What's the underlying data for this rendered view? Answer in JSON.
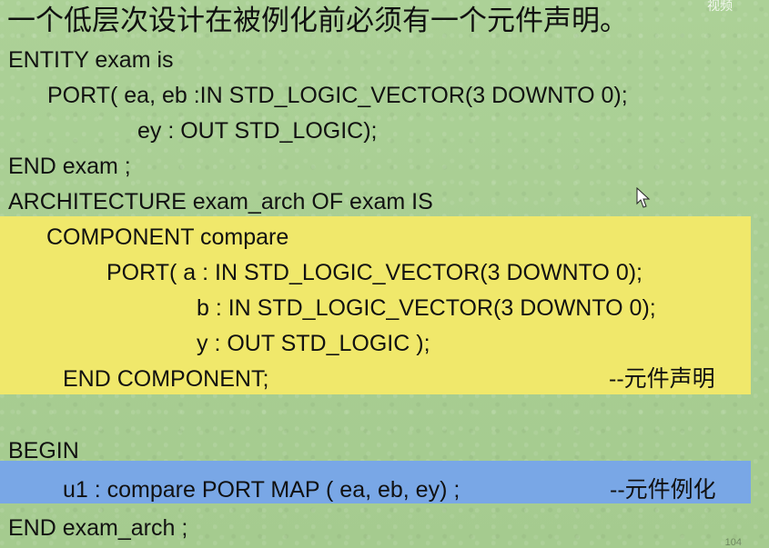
{
  "slide": {
    "title": "一个低层次设计在被例化前必须有一个元件声明。",
    "corner_text": "视频",
    "code_lines": [
      "ENTITY  exam  is",
      "PORT( ea, eb :IN STD_LOGIC_VECTOR(3 DOWNTO 0);",
      "ey : OUT STD_LOGIC);",
      "END  exam ;",
      "ARCHITECTURE exam_arch OF exam IS",
      "COMPONENT compare",
      "PORT( a : IN STD_LOGIC_VECTOR(3 DOWNTO 0);",
      "b : IN STD_LOGIC_VECTOR(3 DOWNTO 0);",
      "y : OUT STD_LOGIC );",
      "END COMPONENT;",
      "BEGIN",
      "u1 : compare  PORT MAP ( ea, eb, ey) ;",
      "END  exam_arch ;"
    ],
    "comments": {
      "component_declaration": "--元件声明",
      "component_instantiation": "--元件例化"
    },
    "page_number": "104"
  },
  "colors": {
    "background": "#a9ce93",
    "yellow_highlight": "#f0e86b",
    "blue_highlight": "#79a7e6"
  },
  "icons": {
    "cursor": "mouse-pointer-icon"
  }
}
